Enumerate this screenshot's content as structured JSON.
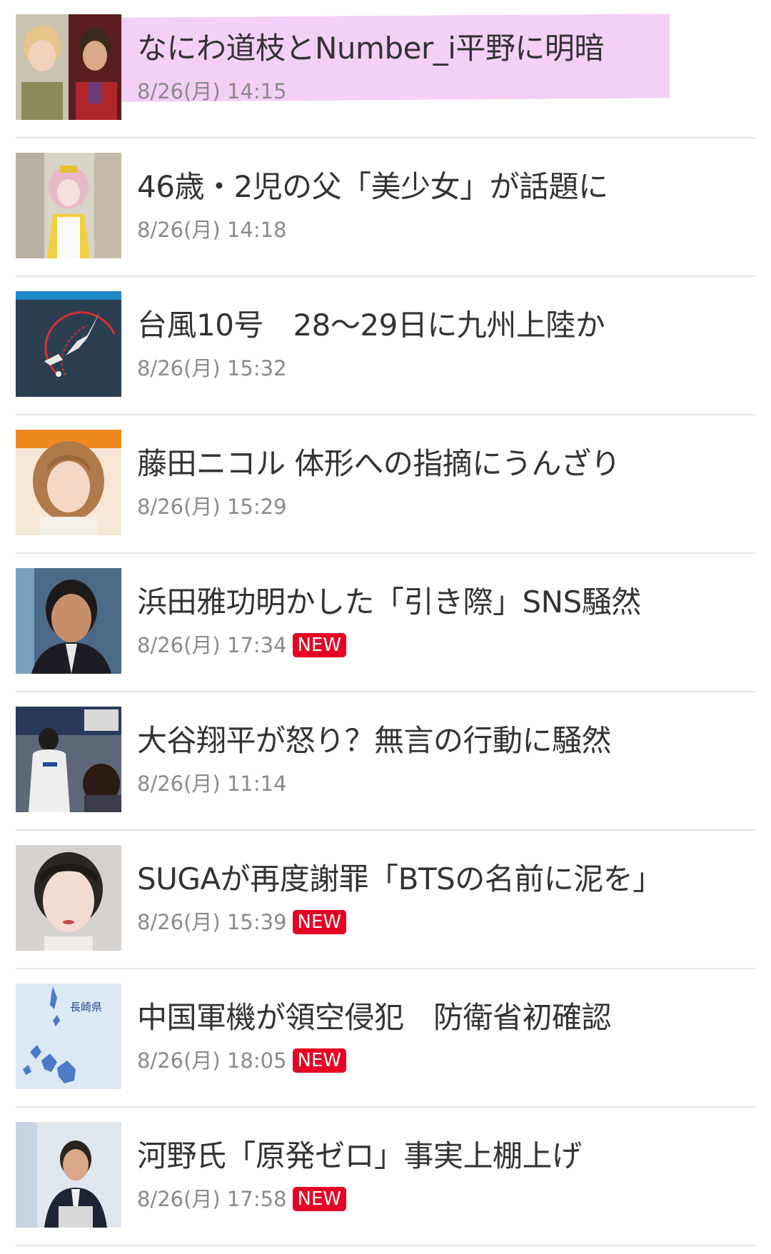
{
  "colors": {
    "headline": "#333333",
    "timestamp": "#8a8a8a",
    "new_badge_bg": "#e60024",
    "highlight": "#f2c7f6",
    "divider": "#e6e6e6"
  },
  "articles": [
    {
      "title": "なにわ道枝とNumber_i平野に明暗",
      "time": "8/26(月) 14:15",
      "badge": "",
      "thumb_icon": "two-actors-photo",
      "highlighted": true
    },
    {
      "title": "46歳・2児の父「美少女」が話題に",
      "time": "8/26(月) 14:18",
      "badge": "",
      "thumb_icon": "cosplay-photo",
      "highlighted": false
    },
    {
      "title": "台風10号　28～29日に九州上陸か",
      "time": "8/26(月) 15:32",
      "badge": "",
      "thumb_icon": "typhoon-map",
      "highlighted": false
    },
    {
      "title": "藤田ニコル 体形への指摘にうんざり",
      "time": "8/26(月) 15:29",
      "badge": "",
      "thumb_icon": "portrait-photo",
      "highlighted": false
    },
    {
      "title": "浜田雅功明かした「引き際」SNS騒然",
      "time": "8/26(月) 17:34",
      "badge": "NEW",
      "thumb_icon": "portrait-photo",
      "highlighted": false
    },
    {
      "title": "大谷翔平が怒り？無言の行動に騒然",
      "time": "8/26(月) 11:14",
      "badge": "",
      "thumb_icon": "baseball-photo",
      "highlighted": false
    },
    {
      "title": "SUGAが再度謝罪「BTSの名前に泥を」",
      "time": "8/26(月) 15:39",
      "badge": "NEW",
      "thumb_icon": "portrait-photo",
      "highlighted": false
    },
    {
      "title": "中国軍機が領空侵犯　防衛省初確認",
      "time": "8/26(月) 18:05",
      "badge": "NEW",
      "thumb_icon": "nagasaki-map",
      "highlighted": false
    },
    {
      "title": "河野氏「原発ゼロ」事実上棚上げ",
      "time": "8/26(月) 17:58",
      "badge": "NEW",
      "thumb_icon": "press-conference-photo",
      "highlighted": false
    }
  ],
  "thumb_text": {
    "map_label": "長崎県"
  }
}
